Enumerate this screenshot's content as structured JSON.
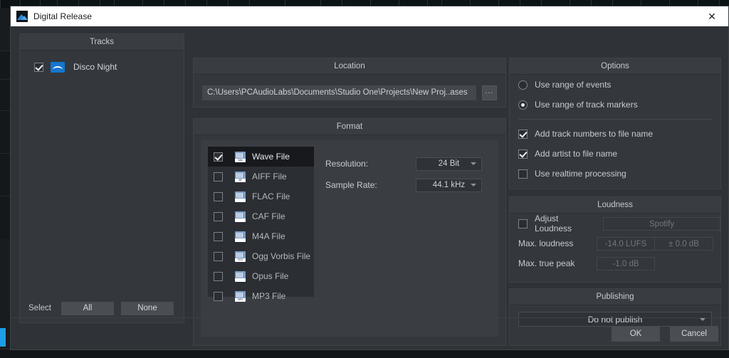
{
  "window": {
    "title": "Digital Release",
    "app_icon": "waveform-app-icon",
    "close_label": "✕"
  },
  "tracks": {
    "header": "Tracks",
    "items": [
      {
        "name": "Disco Night",
        "checked": true,
        "icon": "audio-track-icon"
      }
    ],
    "select_label": "Select",
    "all_label": "All",
    "none_label": "None"
  },
  "location": {
    "header": "Location",
    "path": "C:\\Users\\PCAudioLabs\\Documents\\Studio One\\Projects\\New Proj..ases",
    "browse_label": "..."
  },
  "format": {
    "header": "Format",
    "file_types": [
      {
        "label": "Wave File",
        "tag": "Wav",
        "checked": true
      },
      {
        "label": "AIFF File",
        "tag": "AIF",
        "checked": false
      },
      {
        "label": "FLAC File",
        "tag": "",
        "checked": false
      },
      {
        "label": "CAF File",
        "tag": "",
        "checked": false
      },
      {
        "label": "M4A File",
        "tag": "",
        "checked": false
      },
      {
        "label": "Ogg Vorbis File",
        "tag": "OGG",
        "checked": false
      },
      {
        "label": "Opus File",
        "tag": "",
        "checked": false
      },
      {
        "label": "MP3 File",
        "tag": "MP3",
        "checked": false
      }
    ],
    "resolution_label": "Resolution:",
    "resolution_value": "24 Bit",
    "sample_rate_label": "Sample Rate:",
    "sample_rate_value": "44.1 kHz"
  },
  "options": {
    "header": "Options",
    "radios": [
      {
        "label": "Use range of events",
        "selected": false
      },
      {
        "label": "Use range of track markers",
        "selected": true
      }
    ],
    "checks": [
      {
        "label": "Add track numbers to file name",
        "checked": true
      },
      {
        "label": "Add artist to file name",
        "checked": true
      },
      {
        "label": "Use realtime processing",
        "checked": false
      }
    ]
  },
  "loudness": {
    "header": "Loudness",
    "adjust_label": "Adjust Loudness",
    "adjust_checked": false,
    "preset_value": "Spotify",
    "max_loudness_label": "Max. loudness",
    "max_loudness_value": "-14.0 LUFS",
    "max_loudness_tolerance": "± 0.0 dB",
    "max_true_peak_label": "Max. true peak",
    "max_true_peak_value": "-1.0 dB"
  },
  "publishing": {
    "header": "Publishing",
    "selected": "Do not publish"
  },
  "footer": {
    "ok_label": "OK",
    "cancel_label": "Cancel"
  },
  "colors": {
    "accent_blue": "#1576cf",
    "dialog_bg": "#2f3337",
    "panel_bg": "#34383d",
    "titlebar_bg": "#ffffff"
  }
}
